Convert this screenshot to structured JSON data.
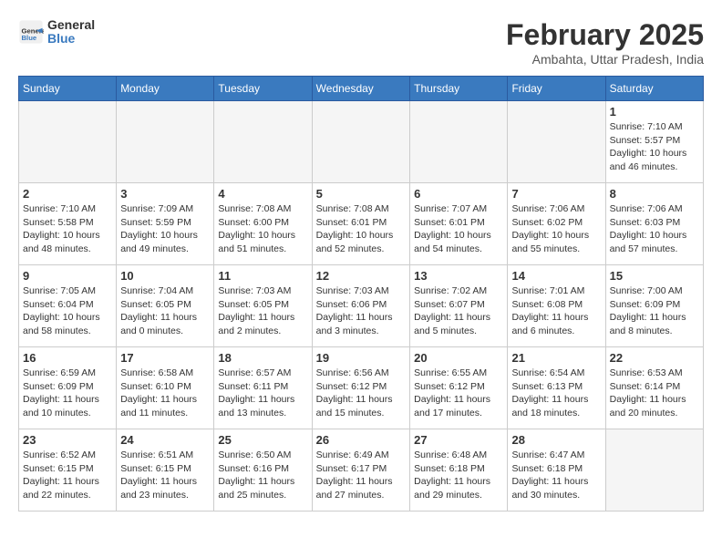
{
  "header": {
    "logo_general": "General",
    "logo_blue": "Blue",
    "month_year": "February 2025",
    "location": "Ambahta, Uttar Pradesh, India"
  },
  "days_of_week": [
    "Sunday",
    "Monday",
    "Tuesday",
    "Wednesday",
    "Thursday",
    "Friday",
    "Saturday"
  ],
  "weeks": [
    [
      {
        "num": "",
        "empty": true
      },
      {
        "num": "",
        "empty": true
      },
      {
        "num": "",
        "empty": true
      },
      {
        "num": "",
        "empty": true
      },
      {
        "num": "",
        "empty": true
      },
      {
        "num": "",
        "empty": true
      },
      {
        "num": "1",
        "sunrise": "7:10 AM",
        "sunset": "5:57 PM",
        "daylight": "10 hours and 46 minutes."
      }
    ],
    [
      {
        "num": "2",
        "sunrise": "7:10 AM",
        "sunset": "5:58 PM",
        "daylight": "10 hours and 48 minutes."
      },
      {
        "num": "3",
        "sunrise": "7:09 AM",
        "sunset": "5:59 PM",
        "daylight": "10 hours and 49 minutes."
      },
      {
        "num": "4",
        "sunrise": "7:08 AM",
        "sunset": "6:00 PM",
        "daylight": "10 hours and 51 minutes."
      },
      {
        "num": "5",
        "sunrise": "7:08 AM",
        "sunset": "6:01 PM",
        "daylight": "10 hours and 52 minutes."
      },
      {
        "num": "6",
        "sunrise": "7:07 AM",
        "sunset": "6:01 PM",
        "daylight": "10 hours and 54 minutes."
      },
      {
        "num": "7",
        "sunrise": "7:06 AM",
        "sunset": "6:02 PM",
        "daylight": "10 hours and 55 minutes."
      },
      {
        "num": "8",
        "sunrise": "7:06 AM",
        "sunset": "6:03 PM",
        "daylight": "10 hours and 57 minutes."
      }
    ],
    [
      {
        "num": "9",
        "sunrise": "7:05 AM",
        "sunset": "6:04 PM",
        "daylight": "10 hours and 58 minutes."
      },
      {
        "num": "10",
        "sunrise": "7:04 AM",
        "sunset": "6:05 PM",
        "daylight": "11 hours and 0 minutes."
      },
      {
        "num": "11",
        "sunrise": "7:03 AM",
        "sunset": "6:05 PM",
        "daylight": "11 hours and 2 minutes."
      },
      {
        "num": "12",
        "sunrise": "7:03 AM",
        "sunset": "6:06 PM",
        "daylight": "11 hours and 3 minutes."
      },
      {
        "num": "13",
        "sunrise": "7:02 AM",
        "sunset": "6:07 PM",
        "daylight": "11 hours and 5 minutes."
      },
      {
        "num": "14",
        "sunrise": "7:01 AM",
        "sunset": "6:08 PM",
        "daylight": "11 hours and 6 minutes."
      },
      {
        "num": "15",
        "sunrise": "7:00 AM",
        "sunset": "6:09 PM",
        "daylight": "11 hours and 8 minutes."
      }
    ],
    [
      {
        "num": "16",
        "sunrise": "6:59 AM",
        "sunset": "6:09 PM",
        "daylight": "11 hours and 10 minutes."
      },
      {
        "num": "17",
        "sunrise": "6:58 AM",
        "sunset": "6:10 PM",
        "daylight": "11 hours and 11 minutes."
      },
      {
        "num": "18",
        "sunrise": "6:57 AM",
        "sunset": "6:11 PM",
        "daylight": "11 hours and 13 minutes."
      },
      {
        "num": "19",
        "sunrise": "6:56 AM",
        "sunset": "6:12 PM",
        "daylight": "11 hours and 15 minutes."
      },
      {
        "num": "20",
        "sunrise": "6:55 AM",
        "sunset": "6:12 PM",
        "daylight": "11 hours and 17 minutes."
      },
      {
        "num": "21",
        "sunrise": "6:54 AM",
        "sunset": "6:13 PM",
        "daylight": "11 hours and 18 minutes."
      },
      {
        "num": "22",
        "sunrise": "6:53 AM",
        "sunset": "6:14 PM",
        "daylight": "11 hours and 20 minutes."
      }
    ],
    [
      {
        "num": "23",
        "sunrise": "6:52 AM",
        "sunset": "6:15 PM",
        "daylight": "11 hours and 22 minutes."
      },
      {
        "num": "24",
        "sunrise": "6:51 AM",
        "sunset": "6:15 PM",
        "daylight": "11 hours and 23 minutes."
      },
      {
        "num": "25",
        "sunrise": "6:50 AM",
        "sunset": "6:16 PM",
        "daylight": "11 hours and 25 minutes."
      },
      {
        "num": "26",
        "sunrise": "6:49 AM",
        "sunset": "6:17 PM",
        "daylight": "11 hours and 27 minutes."
      },
      {
        "num": "27",
        "sunrise": "6:48 AM",
        "sunset": "6:18 PM",
        "daylight": "11 hours and 29 minutes."
      },
      {
        "num": "28",
        "sunrise": "6:47 AM",
        "sunset": "6:18 PM",
        "daylight": "11 hours and 30 minutes."
      },
      {
        "num": "",
        "empty": true
      }
    ]
  ]
}
